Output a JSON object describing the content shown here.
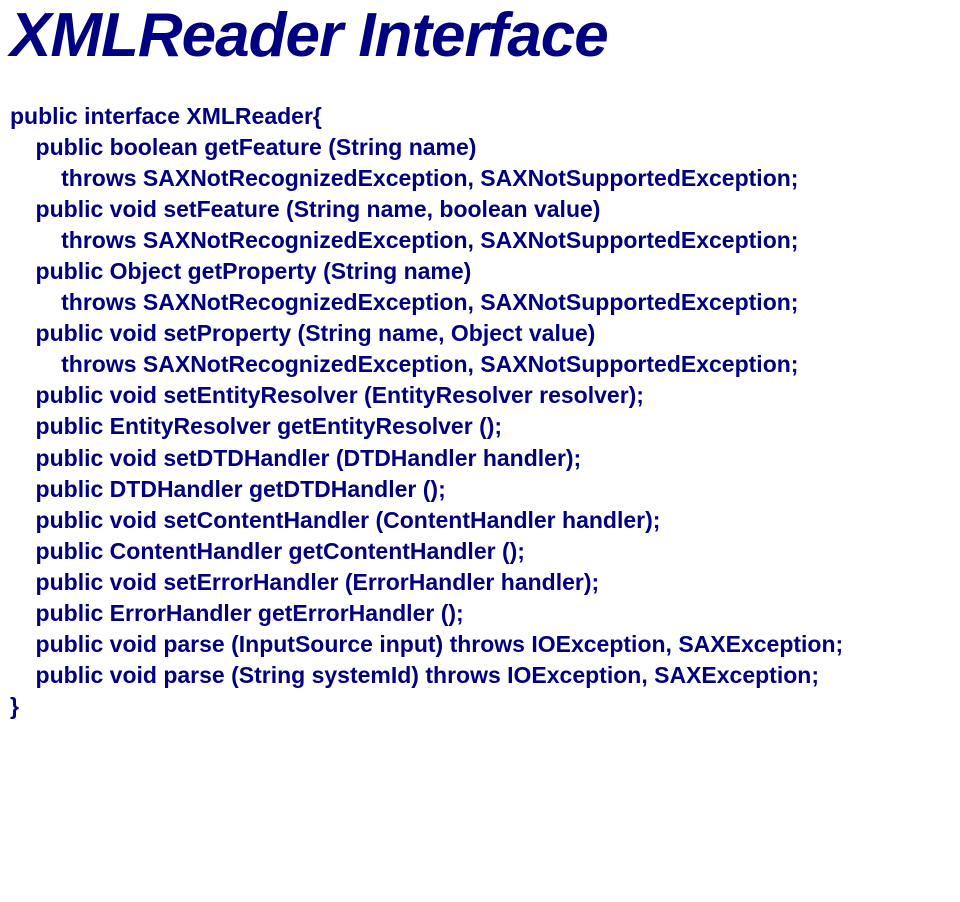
{
  "title": "XMLReader Interface",
  "lines": [
    {
      "indent": 0,
      "text": "public interface XMLReader{"
    },
    {
      "indent": 1,
      "text": "public boolean getFeature (String name)"
    },
    {
      "indent": 2,
      "text": "throws SAXNotRecognizedException, SAXNotSupportedException;"
    },
    {
      "indent": 1,
      "text": "public void setFeature (String name, boolean value)"
    },
    {
      "indent": 2,
      "text": "throws SAXNotRecognizedException, SAXNotSupportedException;"
    },
    {
      "indent": 1,
      "text": "public Object getProperty (String name)"
    },
    {
      "indent": 2,
      "text": "throws SAXNotRecognizedException, SAXNotSupportedException;"
    },
    {
      "indent": 1,
      "text": "public void setProperty (String name, Object value)"
    },
    {
      "indent": 2,
      "text": "throws SAXNotRecognizedException, SAXNotSupportedException;"
    },
    {
      "indent": 1,
      "text": "public void setEntityResolver (EntityResolver resolver);"
    },
    {
      "indent": 1,
      "text": "public EntityResolver getEntityResolver ();"
    },
    {
      "indent": 1,
      "text": "public void setDTDHandler (DTDHandler handler);"
    },
    {
      "indent": 1,
      "text": "public DTDHandler getDTDHandler ();"
    },
    {
      "indent": 1,
      "text": "public void setContentHandler (ContentHandler handler);"
    },
    {
      "indent": 1,
      "text": "public ContentHandler getContentHandler ();"
    },
    {
      "indent": 1,
      "text": "public void setErrorHandler (ErrorHandler handler);"
    },
    {
      "indent": 1,
      "text": "public ErrorHandler getErrorHandler ();"
    },
    {
      "indent": 1,
      "text": "public void parse (InputSource input) throws IOException, SAXException;"
    },
    {
      "indent": 1,
      "text": "public void parse (String systemId) throws IOException, SAXException;"
    },
    {
      "indent": 0,
      "text": "}"
    }
  ],
  "indent_unit": "    "
}
